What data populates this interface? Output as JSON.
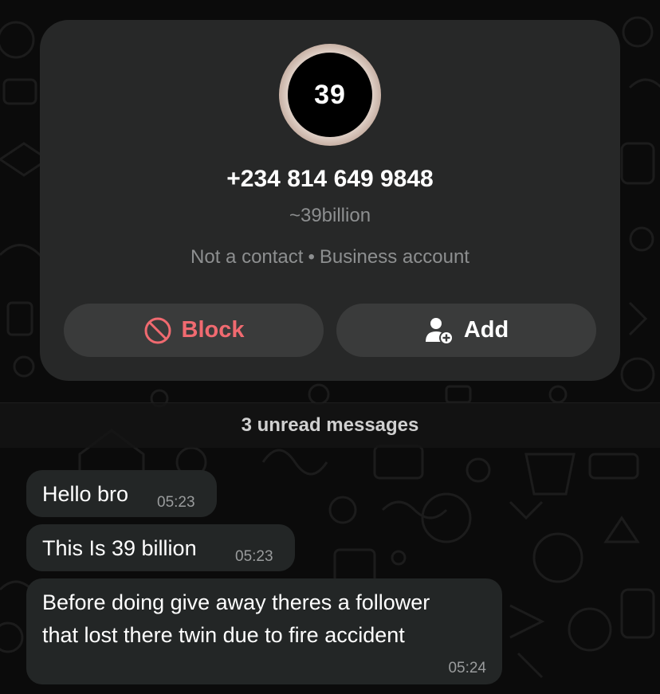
{
  "contact": {
    "avatar_text": "39",
    "phone": "+234 814 649 9848",
    "username": "~39billion",
    "status": "Not a contact",
    "separator": "•",
    "account_type": "Business account"
  },
  "actions": {
    "block_label": "Block",
    "add_label": "Add"
  },
  "chat": {
    "unread_banner": "3 unread messages",
    "messages": [
      {
        "text": "Hello bro",
        "time": "05:23"
      },
      {
        "text": "This Is 39 billion",
        "time": "05:23"
      },
      {
        "lines": [
          "Before doing give away theres a follower",
          "that lost there twin due to fire accident"
        ],
        "time": "05:24"
      }
    ]
  },
  "colors": {
    "background": "#0b0b0b",
    "card": "#272828",
    "button": "#3a3b3b",
    "bubble": "#232626",
    "block_red": "#f06a70",
    "muted_text": "#8d8f90"
  },
  "icons": {
    "block": "block-icon",
    "add": "add-person-icon"
  }
}
